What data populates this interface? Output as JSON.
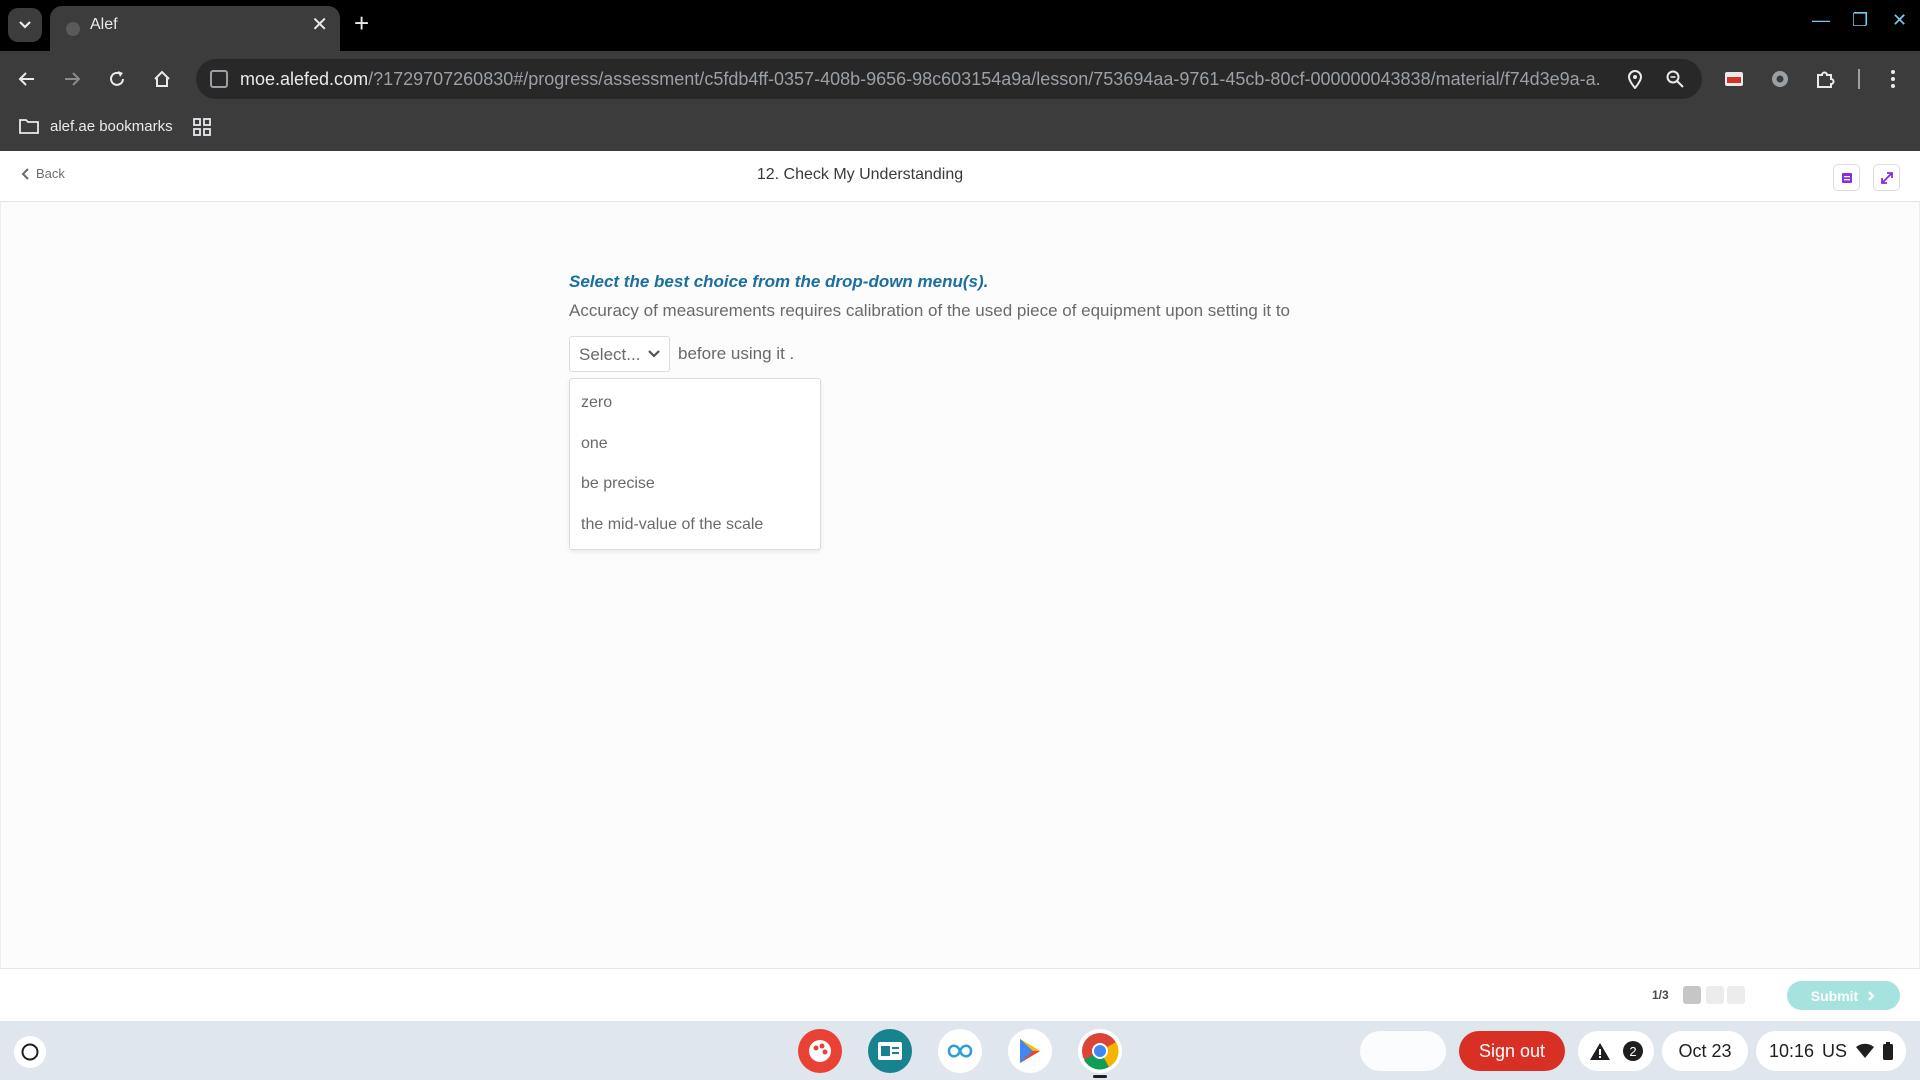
{
  "browser": {
    "tab_title": "Alef",
    "url_host": "moe.alefed.com",
    "url_path": "/?1729707260830#/progress/assessment/c5fdb4ff-0357-408b-9656-98c603154a9a/lesson/753694aa-9761-45cb-80cf-000000043838/material/f74d3e9a-a...",
    "bookmark_folder": "alef.ae bookmarks"
  },
  "header": {
    "back_label": "Back",
    "page_title": "12. Check My Understanding"
  },
  "question": {
    "instruction": "Select the best choice from the drop-down menu(s).",
    "text": "Accuracy  of measurements requires calibration of the used piece of equipment upon setting it to",
    "select_value": "Select...",
    "after_text": "before using it .",
    "options": [
      "zero",
      "one",
      "be precise",
      "the mid-value of the scale"
    ]
  },
  "footer": {
    "progress": "1/3",
    "submit_label": "Submit"
  },
  "shelf": {
    "signout_label": "Sign out",
    "notification_count": "2",
    "date": "Oct 23",
    "time": "10:16",
    "locale": "US"
  }
}
